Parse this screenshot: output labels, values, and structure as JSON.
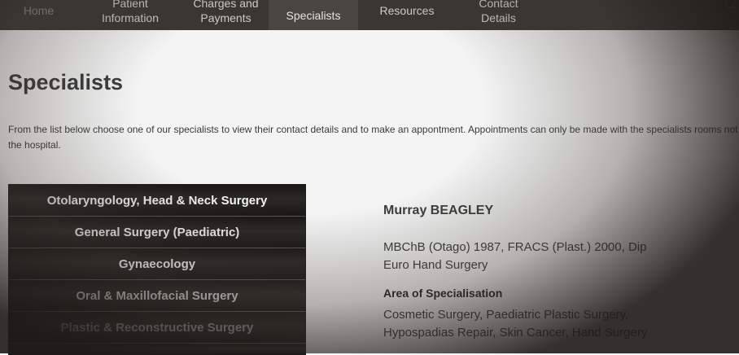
{
  "nav": {
    "home": "Home",
    "patient_info": "Patient\nInformation",
    "charges": "Charges and\nPayments",
    "specialists": "Specialists",
    "resources": "Resources",
    "contact": "Contact\nDetails",
    "search_icon": "search-icon"
  },
  "page": {
    "title": "Specialists",
    "intro": "From the list below choose one of our specialists to view their contact details and to make an appontment. Appointments can only be made with the specialists rooms not the hospital."
  },
  "specialties": [
    "Otolaryngology, Head & Neck Surgery",
    "General Surgery (Paediatric)",
    "Gynaecology",
    "Oral & Maxillofacial Surgery",
    "Plastic & Reconstructive Surgery"
  ],
  "specialist": {
    "name": "Murray BEAGLEY",
    "qualifications": "MBChB (Otago) 1987, FRACS (Plast.) 2000, Dip Euro Hand Surgery",
    "area_heading": "Area of Specialisation",
    "area_text": "Cosmetic Surgery, Paediatric Plastic Surgery, Hypospadias Repair, Skin Cancer, Hand Surgery"
  },
  "colors": {
    "nav_bg": "#3a3631",
    "list_bg": "#1f1d1b"
  }
}
